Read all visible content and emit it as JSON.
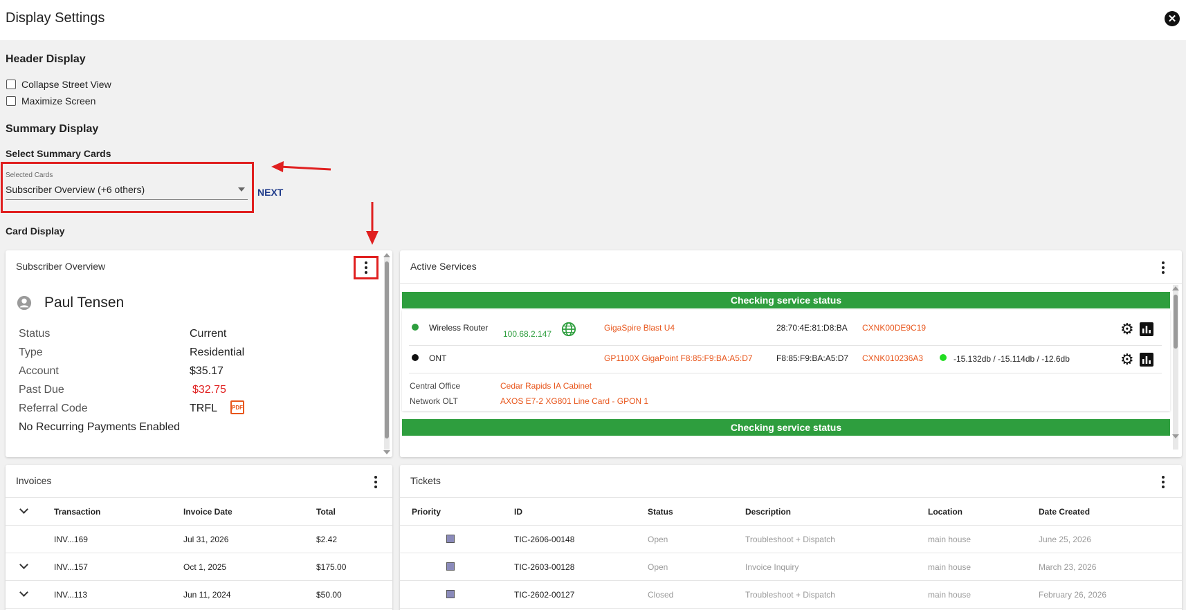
{
  "dialog": {
    "title": "Display Settings"
  },
  "header_display": {
    "heading": "Header Display",
    "options": [
      {
        "label": "Collapse Street View",
        "checked": false
      },
      {
        "label": "Maximize Screen",
        "checked": false
      }
    ]
  },
  "summary_display": {
    "heading": "Summary Display",
    "select_heading": "Select Summary Cards",
    "select_label": "Selected Cards",
    "select_value": "Subscriber Overview (+6 others)",
    "next_label": "NEXT",
    "card_display_heading": "Card Display"
  },
  "subscriber_overview": {
    "title": "Subscriber Overview",
    "name": "Paul Tensen",
    "fields": [
      {
        "key": "Status",
        "value": "Current"
      },
      {
        "key": "Type",
        "value": "Residential"
      },
      {
        "key": "Account",
        "value": "$35.17"
      },
      {
        "key": "Past Due",
        "value": "$32.75"
      },
      {
        "key": "Referral Code",
        "value": "TRFL"
      }
    ],
    "note": "No Recurring Payments Enabled",
    "pdf_icon_text": "PDF"
  },
  "active_services": {
    "title": "Active Services",
    "status_text": "Checking service status",
    "devices": [
      {
        "name": "Wireless Router",
        "ip": "100.68.2.147",
        "model": "GigaSpire Blast U4",
        "mac": "28:70:4E:81:D8:BA",
        "serial": "CXNK00DE9C19",
        "signal": ""
      },
      {
        "name": "ONT",
        "ip": "",
        "model": "GP1100X GigaPoint F8:85:F9:BA:A5:D7",
        "mac": "F8:85:F9:BA:A5:D7",
        "serial": "CXNK010236A3",
        "signal": "-15.132db / -15.114db / -12.6db"
      }
    ],
    "info": [
      {
        "key": "Central Office",
        "value": "Cedar Rapids IA Cabinet"
      },
      {
        "key": "Network OLT",
        "value": "AXOS E7-2 XG801 Line Card - GPON 1"
      }
    ]
  },
  "invoices": {
    "title": "Invoices",
    "columns": [
      "Transaction",
      "Invoice Date",
      "Total"
    ],
    "rows": [
      {
        "transaction": "INV...169",
        "date": "Jul 31, 2026",
        "total": "$2.42",
        "expandable": false
      },
      {
        "transaction": "INV...157",
        "date": "Oct 1, 2025",
        "total": "$175.00",
        "expandable": true
      },
      {
        "transaction": "INV...113",
        "date": "Jun 11, 2024",
        "total": "$50.00",
        "expandable": true
      }
    ]
  },
  "tickets": {
    "title": "Tickets",
    "columns": [
      "Priority",
      "ID",
      "Status",
      "Description",
      "Location",
      "Date Created"
    ],
    "rows": [
      {
        "id": "TIC-2606-00148",
        "status": "Open",
        "description": "Troubleshoot + Dispatch",
        "location": "main house",
        "date": "June 25, 2026"
      },
      {
        "id": "TIC-2603-00128",
        "status": "Open",
        "description": "Invoice Inquiry",
        "location": "main house",
        "date": "March 23, 2026"
      },
      {
        "id": "TIC-2602-00127",
        "status": "Closed",
        "description": "Troubleshoot + Dispatch",
        "location": "main house",
        "date": "February 26, 2026"
      }
    ]
  },
  "colors": {
    "accent_orange": "#e8561c",
    "status_green": "#2e9e3e",
    "annotation_red": "#e02020",
    "link_navy": "#1e3a8a"
  }
}
